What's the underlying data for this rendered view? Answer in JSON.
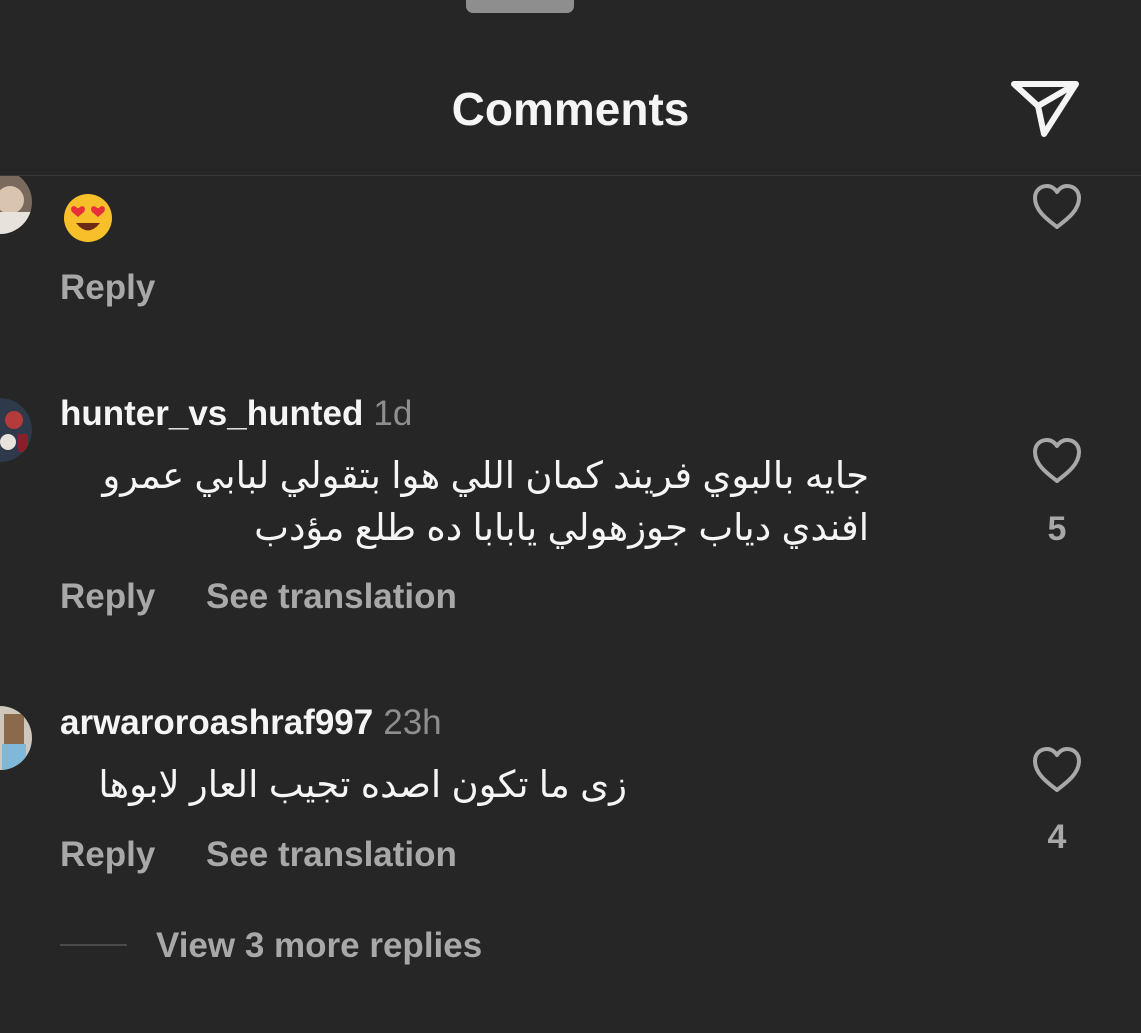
{
  "header": {
    "title": "Comments",
    "share_icon": "send-paper-plane-icon"
  },
  "comments": [
    {
      "username": "",
      "time": "",
      "text_emoji": "heart-eyes-emoji",
      "reply_label": "Reply",
      "like_count": ""
    },
    {
      "username": "hunter_vs_hunted",
      "time": "1d",
      "text_line1": "جايه بالبوي فريند كمان اللي هوا بتقولي لبابي عمرو",
      "text_line2": "افندي دياب جوزهولي يابابا ده طلع مؤدب",
      "reply_label": "Reply",
      "translate_label": "See translation",
      "like_count": "5"
    },
    {
      "username": "arwaroroashraf997",
      "time": "23h",
      "text_line1": "زى ما تكون اصده تجيب العار لابوها",
      "reply_label": "Reply",
      "translate_label": "See translation",
      "like_count": "4"
    }
  ],
  "view_more_label": "View 3 more replies",
  "colors": {
    "background": "#262626",
    "primary_text": "#f5f5f5",
    "secondary_text": "#a8a8a8",
    "divider": "#3a3a3a"
  }
}
